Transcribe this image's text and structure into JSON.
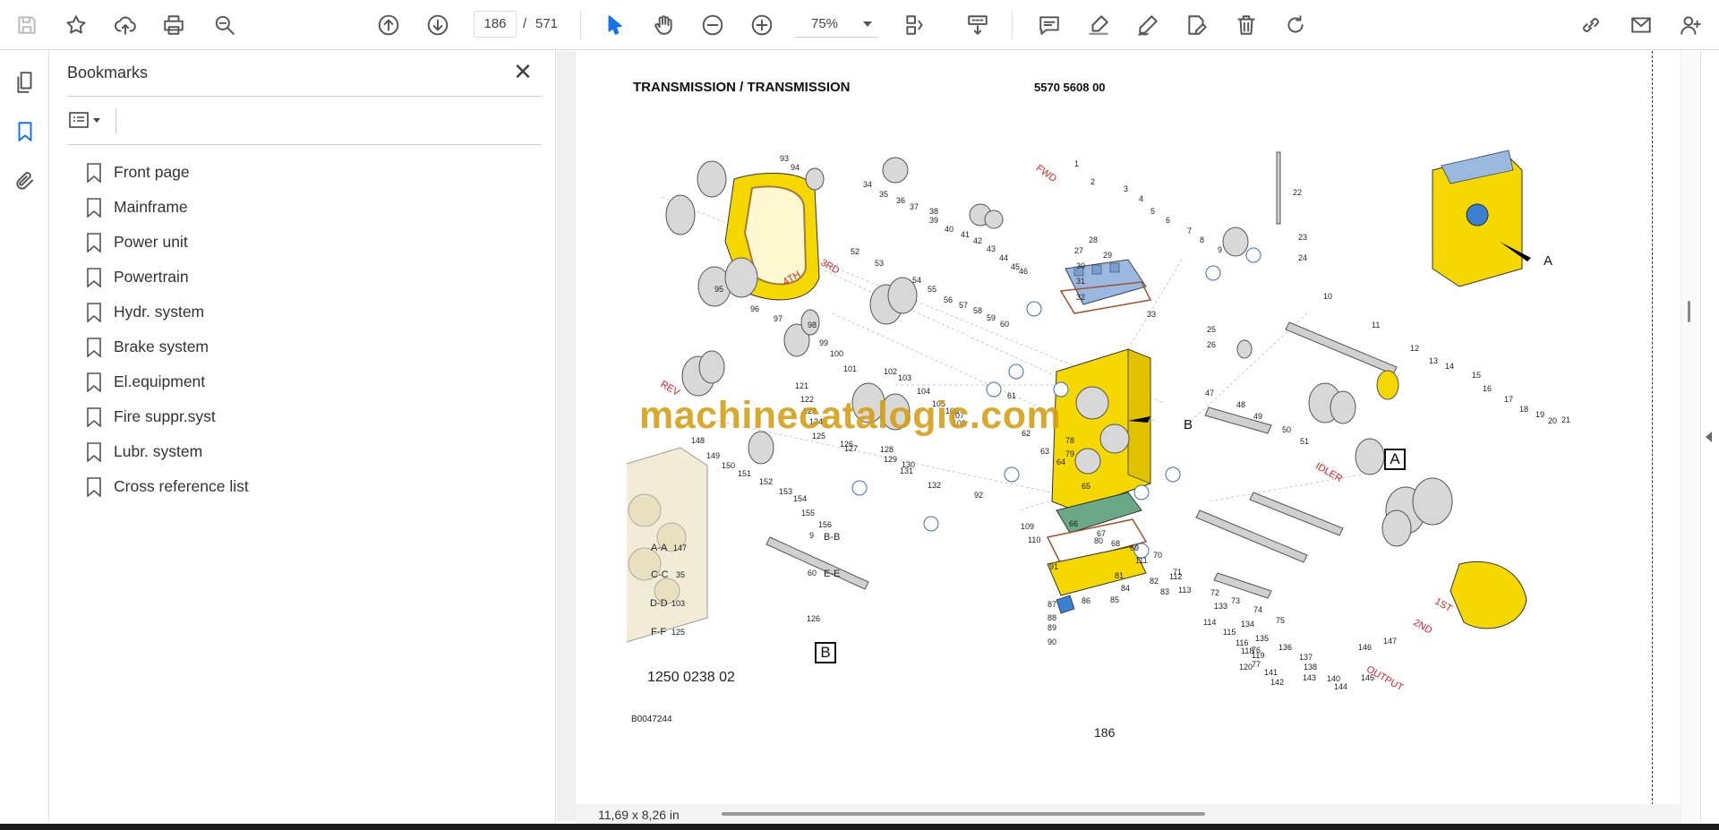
{
  "toolbar": {
    "page_current": "186",
    "page_separator": "/",
    "page_total": "571",
    "zoom": "75%"
  },
  "bookmarks": {
    "title": "Bookmarks",
    "close": "✕",
    "items": [
      "Front page",
      "Mainframe",
      "Power unit",
      "Powertrain",
      "Hydr. system",
      "Brake system",
      "El.equipment",
      "Fire suppr.syst",
      "Lubr. system",
      "Cross reference list"
    ]
  },
  "document": {
    "header_left": "TRANSMISSION / TRANSMISSION",
    "header_right": "5570 5608 00",
    "watermark": "machinecatalogic.com",
    "section_number": "1250 0238 02",
    "figure_ref": "B0047244",
    "page_number": "186",
    "callouts": {
      "A": "A",
      "B": "B"
    },
    "gear_labels": [
      "FWD",
      "REV",
      "4TH",
      "3RD",
      "1ST",
      "2ND",
      "IDLER",
      "OUTPUT"
    ],
    "section_views": [
      "A-A",
      "C-C",
      "D-D",
      "F-F",
      "B-B",
      "E-E"
    ],
    "section_view_part_numbers": [
      "147",
      "35",
      "103",
      "125",
      "9",
      "60",
      "126"
    ],
    "part_numbers": [
      "1",
      "2",
      "3",
      "4",
      "5",
      "6",
      "7",
      "8",
      "9",
      "10",
      "11",
      "12",
      "13",
      "14",
      "15",
      "16",
      "17",
      "18",
      "19",
      "20",
      "21",
      "22",
      "23",
      "24",
      "25",
      "26",
      "27",
      "28",
      "29",
      "30",
      "31",
      "32",
      "33",
      "34",
      "35",
      "36",
      "37",
      "38",
      "39",
      "40",
      "41",
      "42",
      "43",
      "44",
      "45",
      "46",
      "47",
      "48",
      "49",
      "50",
      "51",
      "52",
      "53",
      "54",
      "55",
      "56",
      "57",
      "58",
      "59",
      "60",
      "61",
      "62",
      "63",
      "64",
      "65",
      "66",
      "67",
      "68",
      "69",
      "70",
      "71",
      "72",
      "73",
      "74",
      "75",
      "76",
      "77",
      "78",
      "79",
      "80",
      "81",
      "82",
      "83",
      "84",
      "85",
      "86",
      "87",
      "88",
      "89",
      "90",
      "91",
      "92",
      "93",
      "94",
      "95",
      "96",
      "97",
      "98",
      "99",
      "100",
      "101",
      "102",
      "103",
      "104",
      "105",
      "106",
      "107",
      "108",
      "109",
      "110",
      "111",
      "112",
      "113",
      "114",
      "115",
      "116",
      "118",
      "119",
      "120",
      "121",
      "122",
      "123",
      "124",
      "125",
      "126",
      "127",
      "128",
      "129",
      "130",
      "131",
      "132",
      "133",
      "134",
      "135",
      "136",
      "137",
      "138",
      "140",
      "141",
      "142",
      "143",
      "144",
      "145",
      "146",
      "147",
      "148",
      "149",
      "150",
      "151",
      "152",
      "153",
      "154",
      "155",
      "156"
    ]
  },
  "status": {
    "page_size": "11,69 x 8,26 in"
  },
  "colors": {
    "accent": "#1473e6",
    "housing_yellow": "#f5d800",
    "watermark": "#d4a017",
    "gear_label_red": "#e02020"
  }
}
